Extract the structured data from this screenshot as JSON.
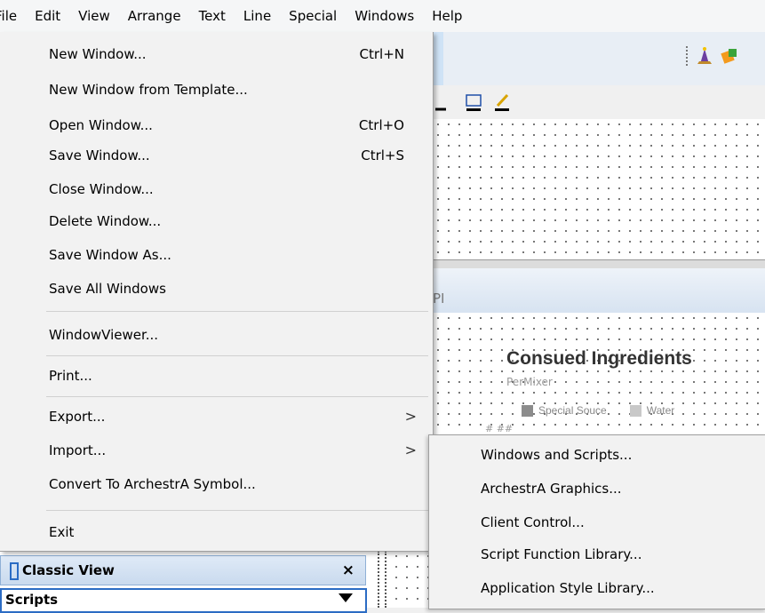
{
  "menubar": {
    "items": [
      "File",
      "Edit",
      "View",
      "Arrange",
      "Text",
      "Line",
      "Special",
      "Windows",
      "Help"
    ]
  },
  "file_menu": {
    "items": [
      {
        "label": "New Window...",
        "shortcut": "Ctrl+N"
      },
      {
        "label": "New Window from Template...",
        "shortcut": ""
      },
      {
        "label": "Open Window...",
        "shortcut": "Ctrl+O"
      },
      {
        "label": "Save Window...",
        "shortcut": "Ctrl+S"
      },
      {
        "label": "Close Window...",
        "shortcut": ""
      },
      {
        "label": "Delete Window...",
        "shortcut": ""
      },
      {
        "label": "Save Window As...",
        "shortcut": ""
      },
      {
        "label": "Save All Windows",
        "shortcut": ""
      },
      {
        "label": "WindowViewer...",
        "shortcut": ""
      },
      {
        "label": "Print...",
        "shortcut": ""
      },
      {
        "label": "Export...",
        "shortcut": "",
        "submenu_arrow": true
      },
      {
        "label": "Import...",
        "shortcut": "",
        "submenu_arrow": true
      },
      {
        "label": "Convert To ArchestrA Symbol...",
        "shortcut": ""
      },
      {
        "label": "Exit",
        "shortcut": ""
      }
    ],
    "submenu_arrow_glyph": ">"
  },
  "import_submenu": {
    "items": [
      "Windows and Scripts...",
      "ArchestrA Graphics...",
      "Client Control...",
      "Script Function Library...",
      "Application Style Library..."
    ]
  },
  "canvas": {
    "partial_title": "PI",
    "chart_title": "Consued Ingredients",
    "chart_subtitle": "PerMixer",
    "legend": [
      {
        "name": "Special Souce",
        "color": "#8c8c8c"
      },
      {
        "name": "Water",
        "color": "#c8c8c8"
      }
    ],
    "axis_label": "# ##"
  },
  "left_panel": {
    "classic_view_title": "Classic View",
    "close_glyph": "×",
    "scripts_label": "Scripts"
  },
  "colors": {
    "menu_bg": "#f2f2f2",
    "panel_accent": "#2b6cc4"
  }
}
